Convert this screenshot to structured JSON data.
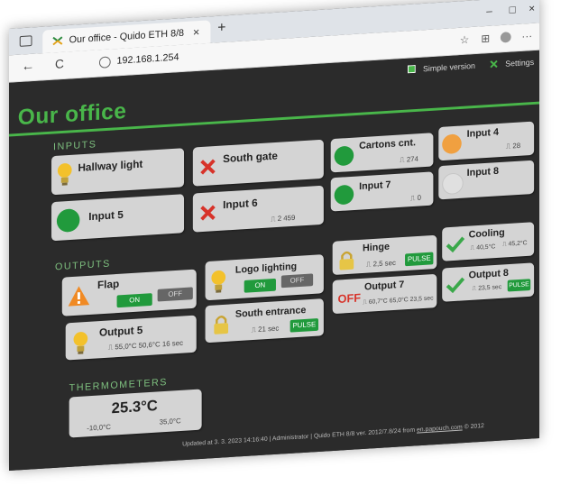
{
  "browser": {
    "tab_title": "Our office - Quido ETH 8/8",
    "close_glyph": "×",
    "new_tab_glyph": "+",
    "url": "192.168.1.254",
    "back_glyph": "←",
    "reload_glyph": "C",
    "minimize_glyph": "–",
    "maximize_glyph": "□",
    "close_window_glyph": "×",
    "favorites_glyph": "☆",
    "collections_glyph": "⊞",
    "more_glyph": "···"
  },
  "topnav": {
    "simple_version": "Simple version",
    "settings": "Settings"
  },
  "page_title": "Our office",
  "sections": {
    "inputs": "INPUTS",
    "outputs": "OUTPUTS",
    "thermometers": "THERMOMETERS"
  },
  "inputs": [
    {
      "name": "Hallway light",
      "icon": "bulb-icon"
    },
    {
      "name": "South gate",
      "icon": "red-x-icon"
    },
    {
      "name": "Cartons cnt.",
      "icon": "green-circle-icon",
      "value": "⎍ 274"
    },
    {
      "name": "Input 4",
      "icon": "orange-circle-icon",
      "value": "⎍ 28"
    },
    {
      "name": "Input 5",
      "icon": "green-circle-icon"
    },
    {
      "name": "Input 6",
      "icon": "red-x-icon",
      "value": "⎍ 2 459"
    },
    {
      "name": "Input 7",
      "icon": "green-circle-icon",
      "value": "⎍ 0"
    },
    {
      "name": "Input 8",
      "icon": "grey-circle-icon"
    }
  ],
  "outputs": {
    "flap": {
      "name": "Flap",
      "on": "ON",
      "off": "OFF"
    },
    "logo": {
      "name": "Logo lighting",
      "on": "ON",
      "off": "OFF"
    },
    "hinge": {
      "name": "Hinge",
      "value": "⎍ 2,5 sec",
      "pulse": "PULSE"
    },
    "cooling": {
      "name": "Cooling",
      "v1": "⎍ 40,5°C",
      "v2": "⎍ 45,2°C"
    },
    "output5": {
      "name": "Output 5",
      "value": "⎍ 55,0°C 50,6°C 16 sec"
    },
    "south_entrance": {
      "name": "South entrance",
      "value": "⎍ 21 sec",
      "pulse": "PULSE"
    },
    "output7": {
      "name": "Output 7",
      "state": "OFF",
      "value": "⎍ 60,7°C 65,0°C 23,5 sec"
    },
    "output8": {
      "name": "Output 8",
      "value": "⎍ 23,5 sec",
      "pulse": "PULSE"
    }
  },
  "thermometer": {
    "value": "25.3°C",
    "min": "-10,0°C",
    "max": "35,0°C"
  },
  "footer": {
    "updated": "Updated at 3. 3. 2023 14:16:40",
    "sep": "|",
    "user": "Administrator",
    "version_prefix": "Quido ETH 8/8 ver. 2012/7.8/24 from",
    "link": "en.papouch.com",
    "year": "© 2012"
  },
  "colors": {
    "accent": "#49b64a",
    "page_bg": "#2b2b2b",
    "card_bg": "#d4d4d4",
    "on": "#219a3c",
    "red": "#d7332a"
  }
}
